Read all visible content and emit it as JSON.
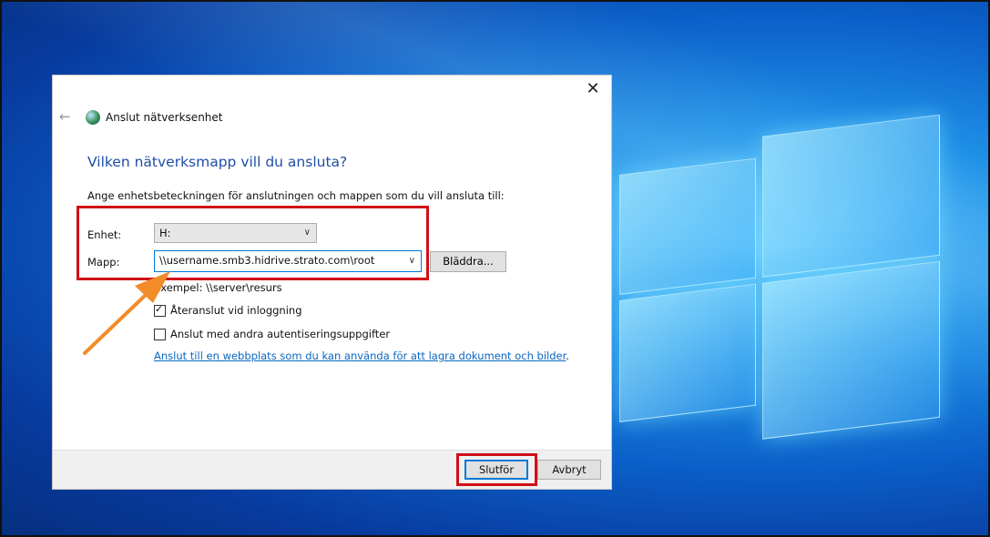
{
  "dialog": {
    "title": "Anslut nätverksenhet",
    "heading": "Vilken nätverksmapp vill du ansluta?",
    "instruction": "Ange enhetsbeteckningen för anslutningen och mappen som du vill ansluta till:",
    "drive_label": "Enhet:",
    "drive_value": "H:",
    "folder_label": "Mapp:",
    "folder_value": "\\\\username.smb3.hidrive.strato.com\\root",
    "browse_label": "Bläddra...",
    "example": "Exempel: \\\\server\\resurs",
    "reconnect_label": "Återanslut vid inloggning",
    "reconnect_checked": true,
    "other_credentials_label": "Anslut med andra autentiseringsuppgifter",
    "other_credentials_checked": false,
    "website_link_text": "Anslut till en webbplats som du kan använda för att lagra dokument och bilder",
    "website_link_suffix": ".",
    "finish_label": "Slutför",
    "cancel_label": "Avbryt"
  },
  "icons": {
    "close": "close-icon",
    "back": "back-arrow-icon",
    "window": "network-drive-icon",
    "dropdown": "chevron-down-icon",
    "checkmark": "checkmark-icon",
    "annotation_arrow": "annotation-arrow"
  },
  "colors": {
    "heading": "#1f4ea8",
    "link": "#0a66c2",
    "highlight_box": "#d10f16",
    "annotation_arrow": "#f28c28",
    "primary_button_border": "#0078d7"
  }
}
